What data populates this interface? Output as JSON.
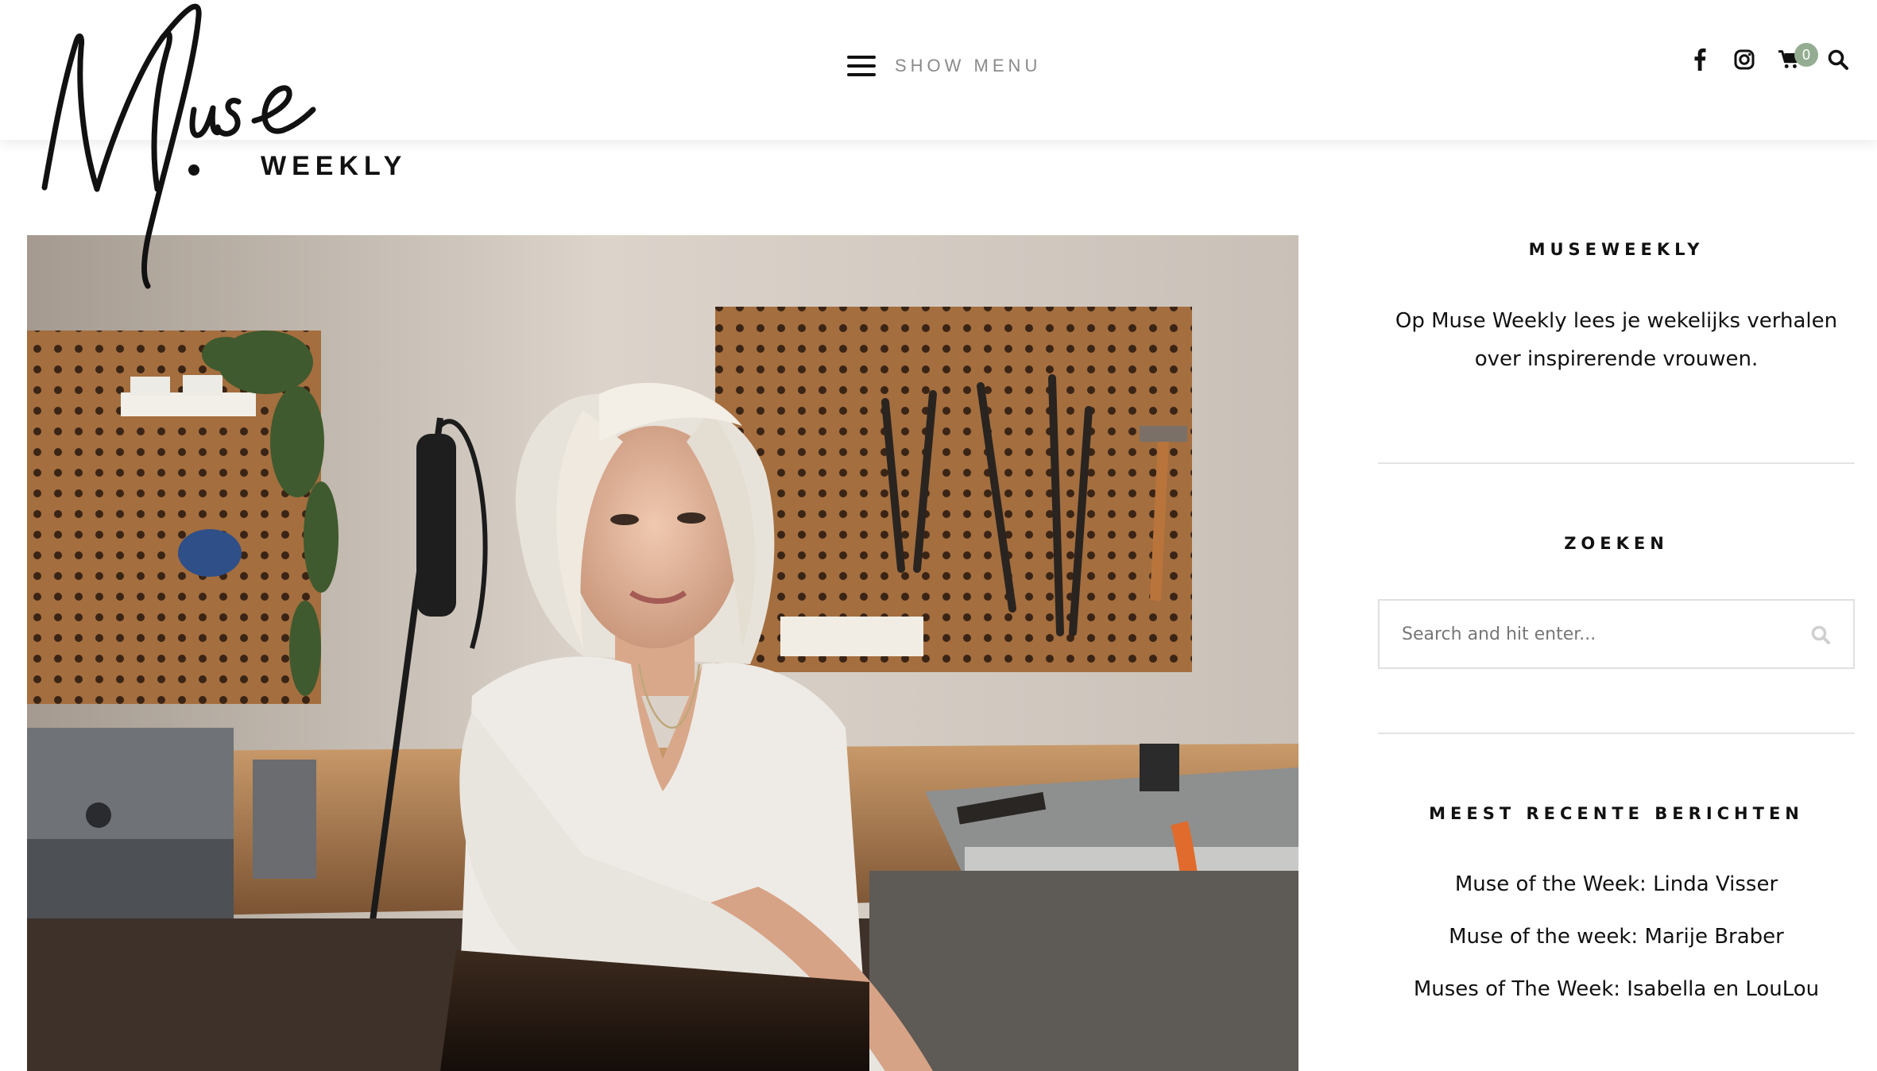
{
  "header": {
    "menu_label": "SHOW MENU",
    "cart_count": "0",
    "icons": [
      "facebook-icon",
      "instagram-icon",
      "cart-icon",
      "search-icon"
    ],
    "badge_color": "#94ad92"
  },
  "logo": {
    "script_text": "Muse",
    "wordmark": "WEEKLY"
  },
  "sidebar": {
    "about": {
      "title": "MUSEWEEKLY",
      "text": "Op Muse Weekly lees je wekelijks verhalen over inspirerende vrouwen."
    },
    "search": {
      "title": "ZOEKEN",
      "placeholder": "Search and hit enter..."
    },
    "recent": {
      "title": "MEEST RECENTE BERICHTEN",
      "items": [
        "Muse of the Week: Linda Visser",
        "Muse of the week: Marije Braber",
        "Muses of The Week: Isabella en LouLou"
      ]
    }
  }
}
